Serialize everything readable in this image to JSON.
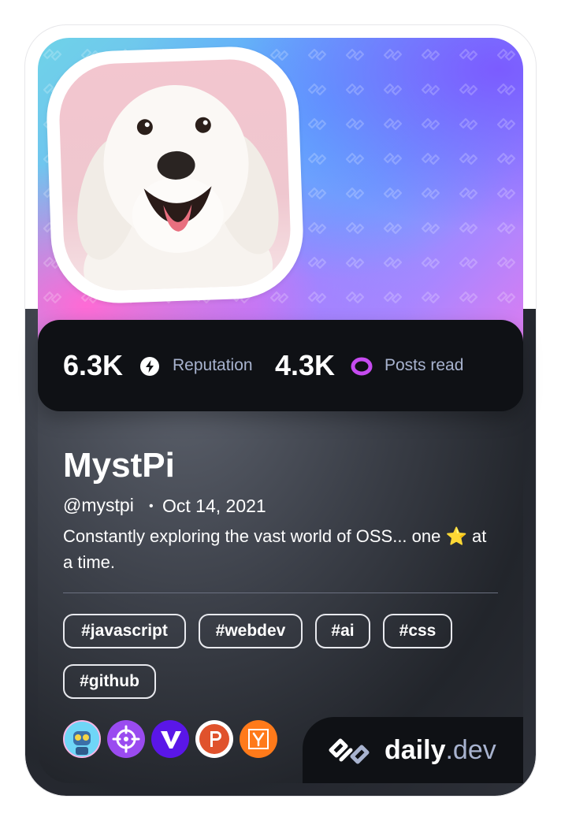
{
  "profile": {
    "name": "MystPi",
    "handle": "@mystpi",
    "separator": "•",
    "joined": "Oct 14, 2021",
    "bio": "Constantly exploring the vast world of OSS... one ⭐ at a time."
  },
  "stats": {
    "reputation_value": "6.3K",
    "reputation_label": "Reputation",
    "posts_value": "4.3K",
    "posts_label": "Posts read"
  },
  "tags": [
    "#javascript",
    "#webdev",
    "#ai",
    "#css",
    "#github"
  ],
  "badges": [
    "robot-avatar-icon",
    "crosshair-icon",
    "v-logo-icon",
    "producthunt-icon",
    "ycombinator-icon"
  ],
  "brand": {
    "name": "daily",
    "suffix": ".dev"
  },
  "colors": {
    "accent_purple": "#c64bf0",
    "muted_text": "#a8b3cf",
    "stats_bg": "#0f1115"
  }
}
